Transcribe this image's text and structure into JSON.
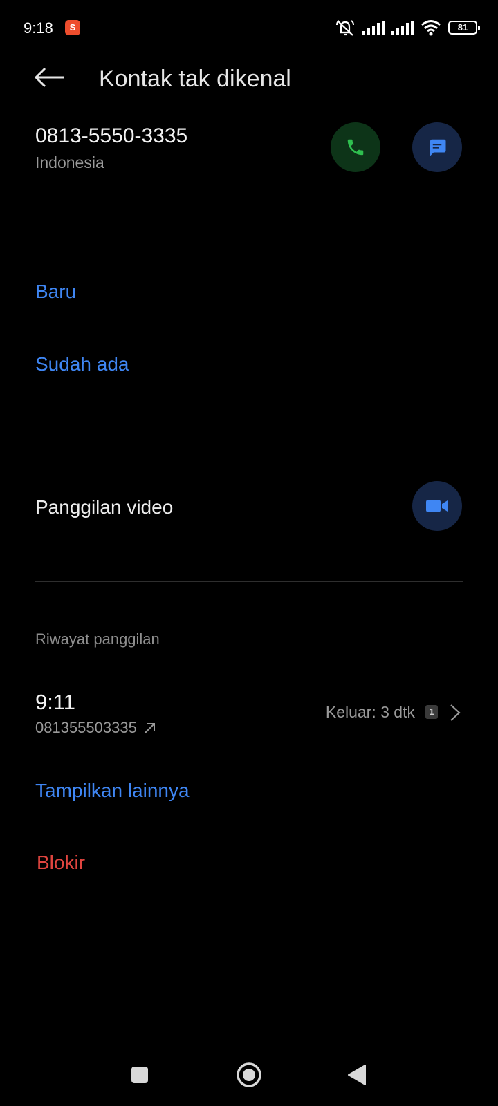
{
  "status_bar": {
    "time": "9:18",
    "shop_badge": "S",
    "battery": "81",
    "icons": [
      "shop-notification-icon",
      "silent-icon",
      "signal-sim1-icon",
      "signal-sim2-icon",
      "wifi-icon",
      "battery-icon"
    ]
  },
  "header": {
    "title": "Kontak tak dikenal",
    "back_icon": "arrow-left-icon"
  },
  "contact": {
    "number": "0813-5550-3335",
    "region": "Indonesia",
    "call_icon": "phone-icon",
    "message_icon": "message-icon"
  },
  "add_options": {
    "new_label": "Baru",
    "existing_label": "Sudah ada"
  },
  "video_call": {
    "label": "Panggilan video",
    "icon": "video-camera-icon"
  },
  "history": {
    "header": "Riwayat panggilan",
    "entries": [
      {
        "time": "9:11",
        "number": "081355503335",
        "direction_icon": "outgoing-arrow-icon",
        "detail": "Keluar: 3 dtk",
        "sim": "1"
      }
    ],
    "show_more_label": "Tampilkan lainnya"
  },
  "block": {
    "label": "Blokir"
  },
  "colors": {
    "background": "#000000",
    "accent_blue": "#3f86f3",
    "call_green": "#2fbf4f",
    "danger_red": "#e0453f",
    "muted_text": "#9a9a9a"
  },
  "navbar": {
    "icons": [
      "recents-square-icon",
      "home-circle-icon",
      "back-triangle-icon"
    ]
  }
}
